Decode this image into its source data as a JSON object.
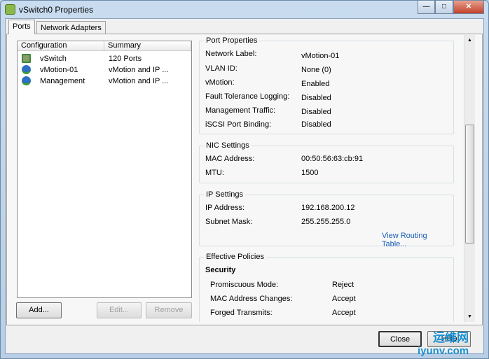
{
  "window": {
    "title": "vSwitch0 Properties",
    "minimize": "—",
    "maximize": "□",
    "close": "✕"
  },
  "tabs": [
    {
      "label": "Ports"
    },
    {
      "label": "Network Adapters"
    }
  ],
  "list": {
    "columns": [
      "Configuration",
      "Summary"
    ],
    "rows": [
      {
        "icon": "vswitch-icon",
        "config": "vSwitch",
        "summary": "120 Ports"
      },
      {
        "icon": "vmkernel-port-icon",
        "config": "vMotion-01",
        "summary": "vMotion and IP ..."
      },
      {
        "icon": "vmkernel-port-icon",
        "config": "Management",
        "summary": "vMotion and IP ..."
      }
    ]
  },
  "buttons": {
    "add": "Add...",
    "edit": "Edit...",
    "remove": "Remove",
    "close": "Close",
    "help": "Help"
  },
  "port_properties": {
    "title": "Port Properties",
    "items": [
      {
        "label": "Network Label:",
        "value": "vMotion-01"
      },
      {
        "label": "VLAN ID:",
        "value": "None (0)"
      },
      {
        "label": "vMotion:",
        "value": "Enabled"
      },
      {
        "label": "Fault Tolerance Logging:",
        "value": "Disabled"
      },
      {
        "label": "Management Traffic:",
        "value": "Disabled"
      },
      {
        "label": "iSCSI Port Binding:",
        "value": "Disabled"
      }
    ]
  },
  "nic_settings": {
    "title": "NIC Settings",
    "items": [
      {
        "label": "MAC Address:",
        "value": "00:50:56:63:cb:91"
      },
      {
        "label": "MTU:",
        "value": "1500"
      }
    ]
  },
  "ip_settings": {
    "title": "IP Settings",
    "items": [
      {
        "label": "IP Address:",
        "value": "192.168.200.12"
      },
      {
        "label": "Subnet Mask:",
        "value": "255.255.255.0"
      }
    ],
    "link": "View Routing Table..."
  },
  "effective_policies": {
    "title": "Effective Policies",
    "section": "Security",
    "items": [
      {
        "label": "Promiscuous Mode:",
        "value": "Reject"
      },
      {
        "label": "MAC Address Changes:",
        "value": "Accept"
      },
      {
        "label": "Forged Transmits:",
        "value": "Accept"
      }
    ]
  },
  "watermark": {
    "line1": "运维网",
    "line2": "iyunv.com"
  }
}
